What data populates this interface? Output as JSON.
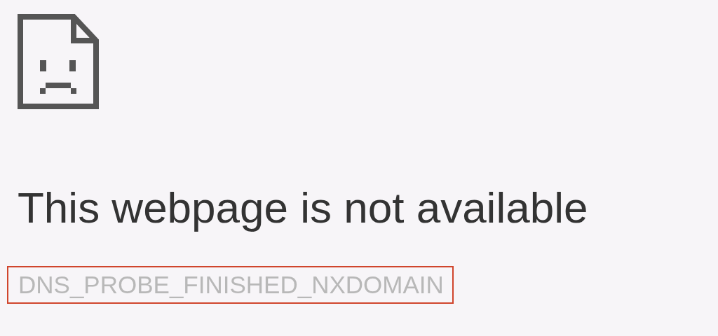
{
  "title": "This webpage is not available",
  "error_code": {
    "text": "DNS_PROBE_FINISHED_NXDOMAIN",
    "highlighted": true
  }
}
